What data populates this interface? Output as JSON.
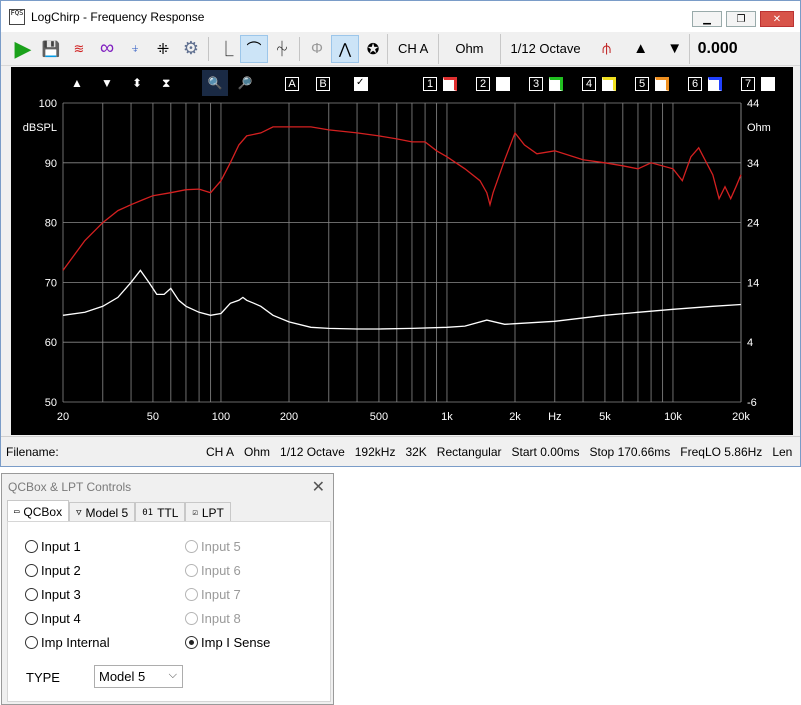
{
  "window": {
    "title": "LogChirp - Frequency Response",
    "app_icon_text": "FQS"
  },
  "toolbar": {
    "channel": "CH A",
    "unit": "Ohm",
    "smoothing": "1/12 Octave",
    "value": "0.000"
  },
  "plot_toolbar": {
    "marker_a": "A",
    "marker_b": "B",
    "traces": [
      "1",
      "2",
      "3",
      "4",
      "5",
      "6",
      "7"
    ],
    "trace_colors": [
      "#e03030",
      "#ffffff",
      "#20c020",
      "#f0e020",
      "#f09020",
      "#2040ff",
      "#ffffff"
    ]
  },
  "chart_data": {
    "type": "line",
    "x_scale": "log",
    "xlim": [
      20,
      20000
    ],
    "x_tick_labels": [
      "20",
      "50",
      "100",
      "200",
      "500",
      "1k",
      "2k",
      "Hz",
      "5k",
      "10k",
      "20k"
    ],
    "y_left": {
      "unit_label": "dBSPL",
      "lim": [
        50,
        100
      ],
      "tick_labels": [
        "100",
        "90",
        "80",
        "70",
        "60",
        "50"
      ]
    },
    "y_right": {
      "unit_label": "Ohm",
      "lim": [
        -6,
        44
      ],
      "tick_labels": [
        "44",
        "34",
        "24",
        "14",
        "4",
        "-6"
      ]
    },
    "grid": true,
    "series": [
      {
        "axis": "left",
        "color": "#d42020",
        "x": [
          20,
          25,
          30,
          35,
          40,
          45,
          50,
          60,
          70,
          80,
          90,
          100,
          110,
          120,
          130,
          150,
          170,
          200,
          250,
          300,
          400,
          500,
          600,
          700,
          800,
          900,
          1000,
          1200,
          1400,
          1500,
          1550,
          1600,
          1800,
          2000,
          2200,
          2500,
          3000,
          4000,
          5000,
          6000,
          7000,
          8000,
          10000,
          11000,
          12000,
          13000,
          15000,
          16000,
          17000,
          18000,
          19000,
          20000
        ],
        "y": [
          72,
          77,
          80,
          82,
          83,
          83.8,
          84.5,
          85,
          85.5,
          85.6,
          85,
          87,
          90,
          93,
          94.5,
          95,
          96,
          96,
          96,
          95.5,
          95,
          94.5,
          94,
          93.5,
          93.5,
          92,
          91,
          89,
          87,
          85,
          83,
          85,
          90.5,
          95,
          93,
          91.5,
          92,
          90.5,
          90,
          89.5,
          89,
          90,
          89,
          87,
          91,
          92.5,
          88,
          84,
          86,
          84,
          86,
          88
        ]
      },
      {
        "axis": "right",
        "color": "#ffffff",
        "x": [
          20,
          25,
          30,
          35,
          40,
          44,
          48,
          52,
          56,
          60,
          65,
          70,
          80,
          90,
          100,
          110,
          120,
          125,
          130,
          140,
          150,
          170,
          200,
          250,
          300,
          400,
          500,
          700,
          1000,
          1200,
          1500,
          1800,
          2000,
          3000,
          5000,
          7000,
          10000,
          15000,
          20000
        ],
        "y": [
          8.5,
          9,
          10,
          11.5,
          14,
          16,
          14,
          12,
          12,
          13,
          11,
          10,
          9,
          8.5,
          8.8,
          10.5,
          11,
          11.5,
          11,
          10.5,
          10,
          8.5,
          7.4,
          6.5,
          6.3,
          6.2,
          6.2,
          6.3,
          6.5,
          6.7,
          7.7,
          7,
          7.1,
          7.5,
          8.5,
          9,
          9.5,
          10,
          10.3
        ]
      }
    ]
  },
  "status": {
    "filename_label": "Filename:",
    "channel": "CH A",
    "unit": "Ohm",
    "smoothing": "1/12 Octave",
    "sample_rate": "192kHz",
    "fft_size": "32K",
    "window": "Rectangular",
    "start": "Start 0.00ms",
    "stop": "Stop 170.66ms",
    "freq_lo": "FreqLO 5.86Hz",
    "len": "Len"
  },
  "qcbox": {
    "title": "QCBox & LPT Controls",
    "close": "✕",
    "tabs": [
      {
        "label": "QCBox",
        "icon": "▭"
      },
      {
        "label": "Model 5",
        "icon": "▽"
      },
      {
        "label": "TTL",
        "icon": "01"
      },
      {
        "label": "LPT",
        "icon": "☑"
      }
    ],
    "inputs_left": [
      "Input 1",
      "Input 2",
      "Input 3",
      "Input 4",
      "Imp Internal"
    ],
    "inputs_right": [
      "Input 5",
      "Input 6",
      "Input 7",
      "Input 8",
      "Imp I Sense"
    ],
    "type_label": "TYPE",
    "type_value": "Model 5"
  }
}
